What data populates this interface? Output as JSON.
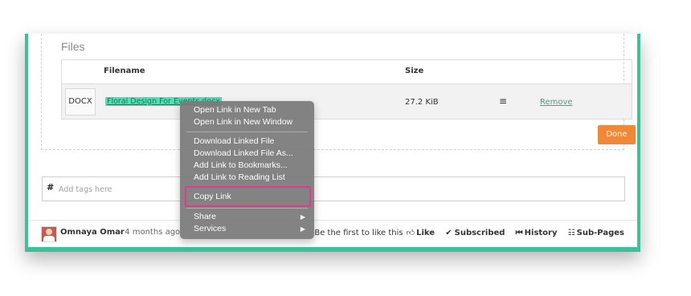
{
  "files": {
    "title": "Files",
    "columns": {
      "filename": "Filename",
      "size": "Size"
    },
    "rows": [
      {
        "type": "DOCX",
        "filename": "Floral Design For Events.docx",
        "size": "27.2 KiB",
        "remove_label": "Remove"
      }
    ],
    "done_label": "Done"
  },
  "tags": {
    "hash": "#",
    "placeholder": "Add tags here"
  },
  "footer": {
    "author": "Omnaya Omar",
    "ago": "– 4 months ago",
    "like_prompt": "Be the first to like this",
    "like_label": "Like",
    "subscribed_label": "Subscribed",
    "history_label": "History",
    "subpages_label": "Sub-Pages"
  },
  "context_menu": {
    "items": [
      "Open Link in New Tab",
      "Open Link in New Window",
      "Download Linked File",
      "Download Linked File As...",
      "Add Link to Bookmarks...",
      "Add Link to Reading List",
      "Copy Link",
      "Share",
      "Services"
    ],
    "highlighted": "Copy Link",
    "highlight_color": "#e43a8a"
  },
  "colors": {
    "accent": "#3fc09a",
    "done": "#f0883a",
    "link": "#2fae86"
  }
}
